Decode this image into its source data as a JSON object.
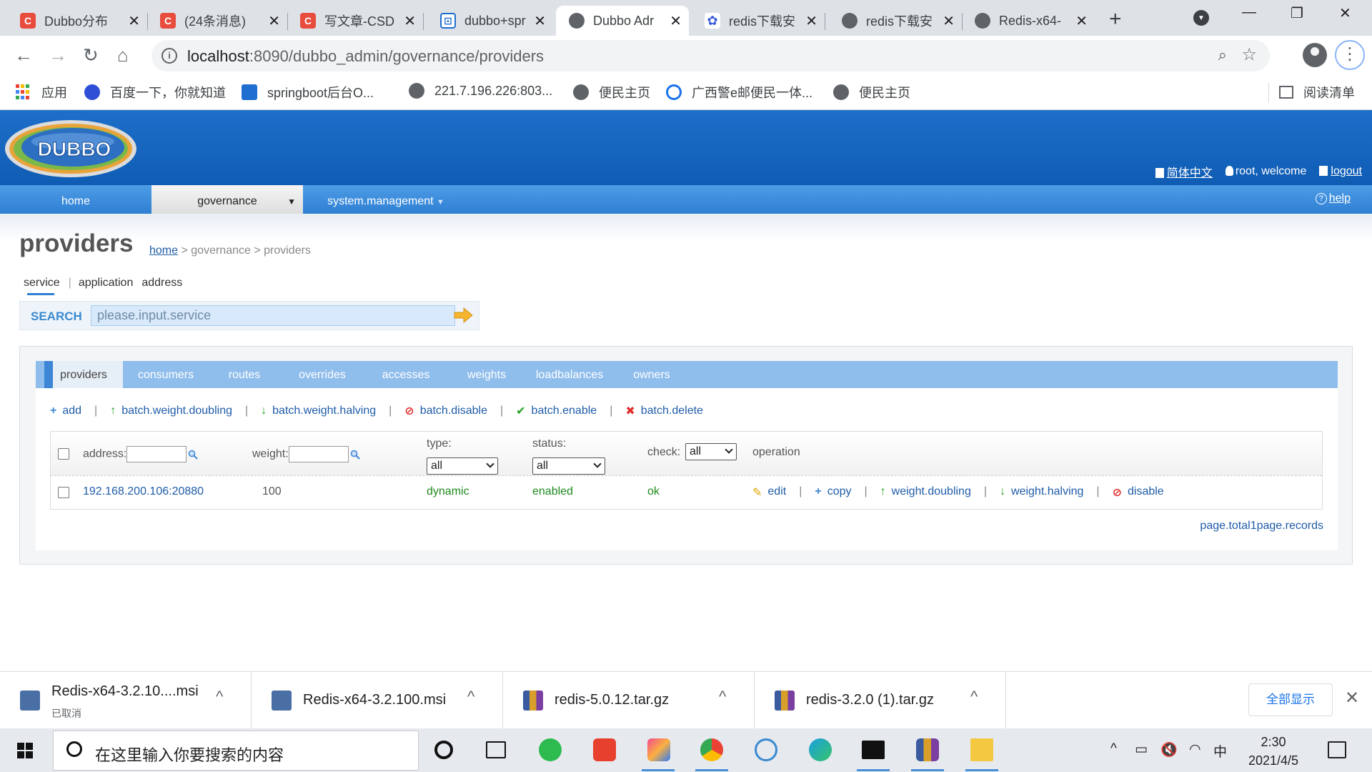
{
  "browser": {
    "tabs": [
      {
        "title": "Dubbo分布",
        "icon": "csdn-icon",
        "kind": "c"
      },
      {
        "title": "(24条消息)",
        "icon": "csdn-icon",
        "kind": "c"
      },
      {
        "title": "写文章-CSD",
        "icon": "csdn-icon",
        "kind": "c"
      },
      {
        "title": "dubbo+spr",
        "icon": "bracket-icon",
        "kind": "b"
      },
      {
        "title": "Dubbo Adr",
        "icon": "globe-icon",
        "kind": "g"
      },
      {
        "title": "redis下载安",
        "icon": "baidu-paw-icon",
        "kind": "p"
      },
      {
        "title": "redis下载安",
        "icon": "bird-icon",
        "kind": "g"
      },
      {
        "title": "Redis-x64-",
        "icon": "cloud-icon",
        "kind": "g"
      }
    ],
    "url_host": "localhost",
    "url_rest": ":8090/dubbo_admin/governance/providers",
    "bookmarks": [
      {
        "label": "应用"
      },
      {
        "label": "百度一下，你就知道"
      },
      {
        "label": "springboot后台O..."
      },
      {
        "label": "221.7.196.226:803..."
      },
      {
        "label": "便民主页"
      },
      {
        "label": "广西警e邮便民一体..."
      },
      {
        "label": "便民主页"
      }
    ],
    "reading_list": "阅读清单"
  },
  "header": {
    "logo_text": "DUBBO",
    "lang_link": "简体中文",
    "user_text": "root, welcome",
    "logout": "logout"
  },
  "menu": {
    "items": [
      "home",
      "governance",
      "system.management"
    ],
    "help": "help"
  },
  "page": {
    "title": "providers",
    "crumb_home": "home",
    "crumb_rest": " > governance > providers",
    "subtabs": [
      "service",
      "application",
      "address"
    ],
    "search_label": "SEARCH",
    "search_placeholder": "please.input.service"
  },
  "panel": {
    "tabs": [
      "providers",
      "consumers",
      "routes",
      "overrides",
      "accesses",
      "weights",
      "loadbalances",
      "owners"
    ],
    "actions": [
      {
        "label": "add",
        "icon": "+",
        "color": "#3d86d6"
      },
      {
        "label": "batch.weight.doubling",
        "icon": "↑",
        "color": "#22a022"
      },
      {
        "label": "batch.weight.halving",
        "icon": "↓",
        "color": "#22a022"
      },
      {
        "label": "batch.disable",
        "icon": "⊘",
        "color": "#e03030"
      },
      {
        "label": "batch.enable",
        "icon": "✔",
        "color": "#22a022"
      },
      {
        "label": "batch.delete",
        "icon": "✖",
        "color": "#e03030"
      }
    ],
    "columns": {
      "address": "address:",
      "weight": "weight:",
      "type": "type:",
      "type_value": "all",
      "status": "status:",
      "status_value": "all",
      "check": "check:",
      "check_value": "all",
      "operation": "operation"
    },
    "rows": [
      {
        "address": "192.168.200.106:20880",
        "weight": "100",
        "type": "dynamic",
        "status": "enabled",
        "check": "ok",
        "ops": [
          {
            "label": "edit",
            "icon": "✎",
            "color": "#d9a400"
          },
          {
            "label": "copy",
            "icon": "+",
            "color": "#3d86d6"
          },
          {
            "label": "weight.doubling",
            "icon": "↑",
            "color": "#22a022"
          },
          {
            "label": "weight.halving",
            "icon": "↓",
            "color": "#22a022"
          },
          {
            "label": "disable",
            "icon": "⊘",
            "color": "#e03030"
          }
        ]
      }
    ],
    "pager": "page.total1page.records"
  },
  "downloads": {
    "items": [
      {
        "name": "Redis-x64-3.2.10....msi",
        "sub": "已取消"
      },
      {
        "name": "Redis-x64-3.2.100.msi",
        "sub": ""
      },
      {
        "name": "redis-5.0.12.tar.gz",
        "sub": ""
      },
      {
        "name": "redis-3.2.0 (1).tar.gz",
        "sub": ""
      }
    ],
    "show_all": "全部显示"
  },
  "taskbar": {
    "search_text": "在这里输入你要搜索的内容",
    "ime": "中",
    "time": "2:30",
    "date": "2021/4/5"
  }
}
